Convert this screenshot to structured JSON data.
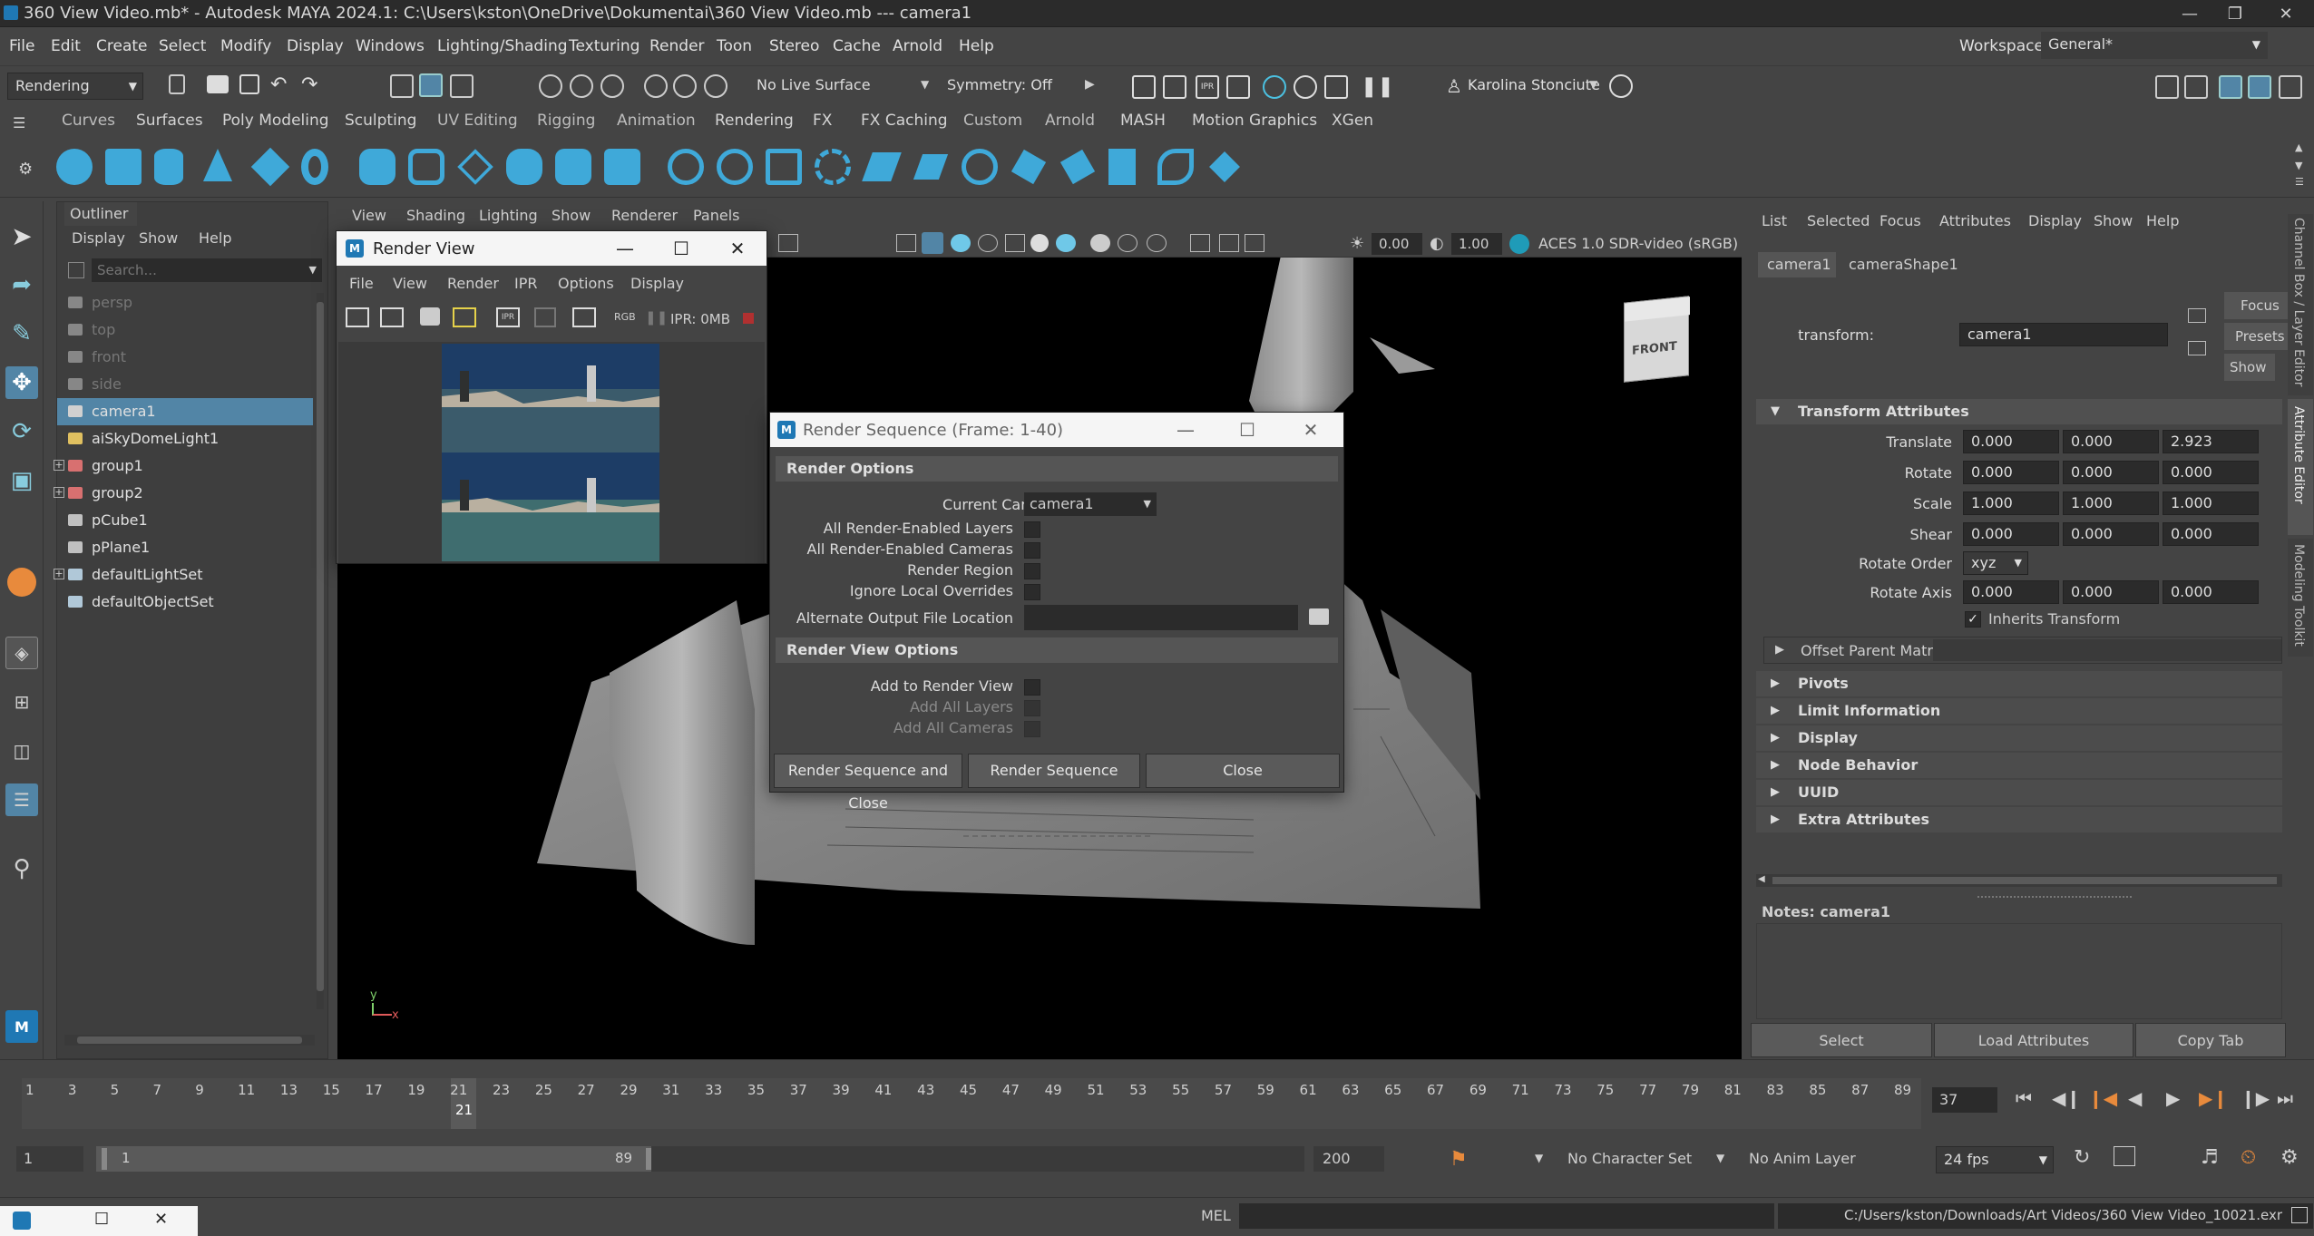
{
  "window": {
    "title": "360 View Video.mb* - Autodesk MAYA 2024.1: C:\\Users\\kston\\OneDrive\\Dokumentai\\360 View Video.mb   ---   camera1"
  },
  "menubar": {
    "items": [
      "File",
      "Edit",
      "Create",
      "Select",
      "Modify",
      "Display",
      "Windows",
      "Lighting/Shading",
      "Texturing",
      "Render",
      "Toon",
      "Stereo",
      "Cache",
      "Arnold",
      "Help"
    ],
    "workspace_label": "Workspace:",
    "workspace_value": "General*"
  },
  "statusline": {
    "menuset": "Rendering",
    "live_surface": "No Live Surface",
    "symmetry": "Symmetry: Off",
    "user": "Karolina Stonciute"
  },
  "shelf": {
    "tabs": [
      "Curves",
      "Surfaces",
      "Poly Modeling",
      "Sculpting",
      "UV Editing",
      "Rigging",
      "Animation",
      "Rendering",
      "FX",
      "FX Caching",
      "Custom",
      "Arnold",
      "MASH",
      "Motion Graphics",
      "XGen"
    ]
  },
  "outliner": {
    "title": "Outliner",
    "menu": [
      "Display",
      "Show",
      "Help"
    ],
    "search_placeholder": "Search...",
    "items": [
      {
        "label": "persp",
        "dim": true,
        "expander": false,
        "icon": "camera-icon"
      },
      {
        "label": "top",
        "dim": true,
        "expander": false,
        "icon": "camera-icon"
      },
      {
        "label": "front",
        "dim": true,
        "expander": false,
        "icon": "camera-icon"
      },
      {
        "label": "side",
        "dim": true,
        "expander": false,
        "icon": "camera-icon"
      },
      {
        "label": "camera1",
        "dim": false,
        "selected": true,
        "expander": false,
        "icon": "camera-icon"
      },
      {
        "label": "aiSkyDomeLight1",
        "dim": false,
        "expander": false,
        "icon": "light-icon"
      },
      {
        "label": "group1",
        "dim": false,
        "expander": true,
        "icon": "group-icon"
      },
      {
        "label": "group2",
        "dim": false,
        "expander": true,
        "icon": "group-icon"
      },
      {
        "label": "pCube1",
        "dim": false,
        "expander": false,
        "icon": "mesh-icon"
      },
      {
        "label": "pPlane1",
        "dim": false,
        "expander": false,
        "icon": "mesh-icon"
      },
      {
        "label": "defaultLightSet",
        "dim": false,
        "expander": true,
        "icon": "set-icon"
      },
      {
        "label": "defaultObjectSet",
        "dim": false,
        "expander": false,
        "icon": "set-icon"
      }
    ]
  },
  "viewport": {
    "menu": [
      "View",
      "Shading",
      "Lighting",
      "Show",
      "Renderer",
      "Panels"
    ],
    "exposure": "0.00",
    "gamma": "1.00",
    "colorspace": "ACES 1.0 SDR-video (sRGB)",
    "viewcube_label": "FRONT",
    "axis_y": "y",
    "axis_x": "x"
  },
  "render_view": {
    "title": "Render View",
    "menu": [
      "File",
      "View",
      "Render",
      "IPR",
      "Options",
      "Display"
    ],
    "ipr_memory": "IPR: 0MB",
    "rgb_label": "RGB"
  },
  "render_sequence": {
    "title": "Render Sequence (Frame: 1-40)",
    "render_options_header": "Render Options",
    "current_camera_label": "Current Camera",
    "current_camera_value": "camera1",
    "options": [
      "All Render-Enabled Layers",
      "All Render-Enabled Cameras",
      "Render Region",
      "Ignore Local Overrides"
    ],
    "alt_output_label": "Alternate Output File Location",
    "render_view_options_header": "Render View Options",
    "view_options": [
      {
        "label": "Add to Render View",
        "enabled": true
      },
      {
        "label": "Add All Layers",
        "enabled": false
      },
      {
        "label": "Add All Cameras",
        "enabled": false
      }
    ],
    "buttons": [
      "Render Sequence and Close",
      "Render Sequence",
      "Close"
    ]
  },
  "attribute_editor": {
    "menu": [
      "List",
      "Selected",
      "Focus",
      "Attributes",
      "Display",
      "Show",
      "Help"
    ],
    "tabs": [
      "camera1",
      "cameraShape1"
    ],
    "transform_label": "transform:",
    "transform_value": "camera1",
    "focus_btn": "Focus",
    "presets_btn": "Presets",
    "show_btn": "Show",
    "transform_header": "Transform Attributes",
    "rows": [
      {
        "label": "Translate",
        "values": [
          "0.000",
          "0.000",
          "2.923"
        ]
      },
      {
        "label": "Rotate",
        "values": [
          "0.000",
          "0.000",
          "0.000"
        ]
      },
      {
        "label": "Scale",
        "values": [
          "1.000",
          "1.000",
          "1.000"
        ]
      },
      {
        "label": "Shear",
        "values": [
          "0.000",
          "0.000",
          "0.000"
        ]
      }
    ],
    "rotate_order_label": "Rotate Order",
    "rotate_order_value": "xyz",
    "rotate_axis_label": "Rotate Axis",
    "rotate_axis_values": [
      "0.000",
      "0.000",
      "0.000"
    ],
    "inherits_label": "Inherits Transform",
    "offset_parent_label": "Offset Parent Matrix",
    "sections": [
      "Pivots",
      "Limit Information",
      "Display",
      "Node Behavior",
      "UUID",
      "Extra Attributes"
    ],
    "notes_label": "Notes:  camera1",
    "bottom_buttons": [
      "Select",
      "Load Attributes",
      "Copy Tab"
    ],
    "side_tabs": [
      "Channel Box / Layer Editor",
      "Attribute Editor",
      "Modeling Toolkit"
    ]
  },
  "timeline": {
    "ticks": [
      "1",
      "3",
      "5",
      "7",
      "9",
      "11",
      "13",
      "15",
      "17",
      "19",
      "21",
      "23",
      "25",
      "27",
      "29",
      "31",
      "33",
      "35",
      "37",
      "39",
      "41",
      "43",
      "45",
      "47",
      "49",
      "51",
      "53",
      "55",
      "57",
      "59",
      "61",
      "63",
      "65",
      "67",
      "69",
      "71",
      "73",
      "75",
      "77",
      "79",
      "81",
      "83",
      "85",
      "87",
      "89"
    ],
    "current_marker": "21",
    "current_frame": "37"
  },
  "range": {
    "start": "1",
    "range_start": "1",
    "range_end": "89",
    "end": "200",
    "character_set": "No Character Set",
    "anim_layer": "No Anim Layer",
    "fps": "24 fps"
  },
  "cmdline": {
    "lang": "MEL",
    "path": "C:/Users/kston/Downloads/Art Videos/360 View Video_10021.exr"
  },
  "colors": {
    "selection": "#5285a6",
    "accent": "#1f78b4",
    "orange": "#e88a3c"
  }
}
